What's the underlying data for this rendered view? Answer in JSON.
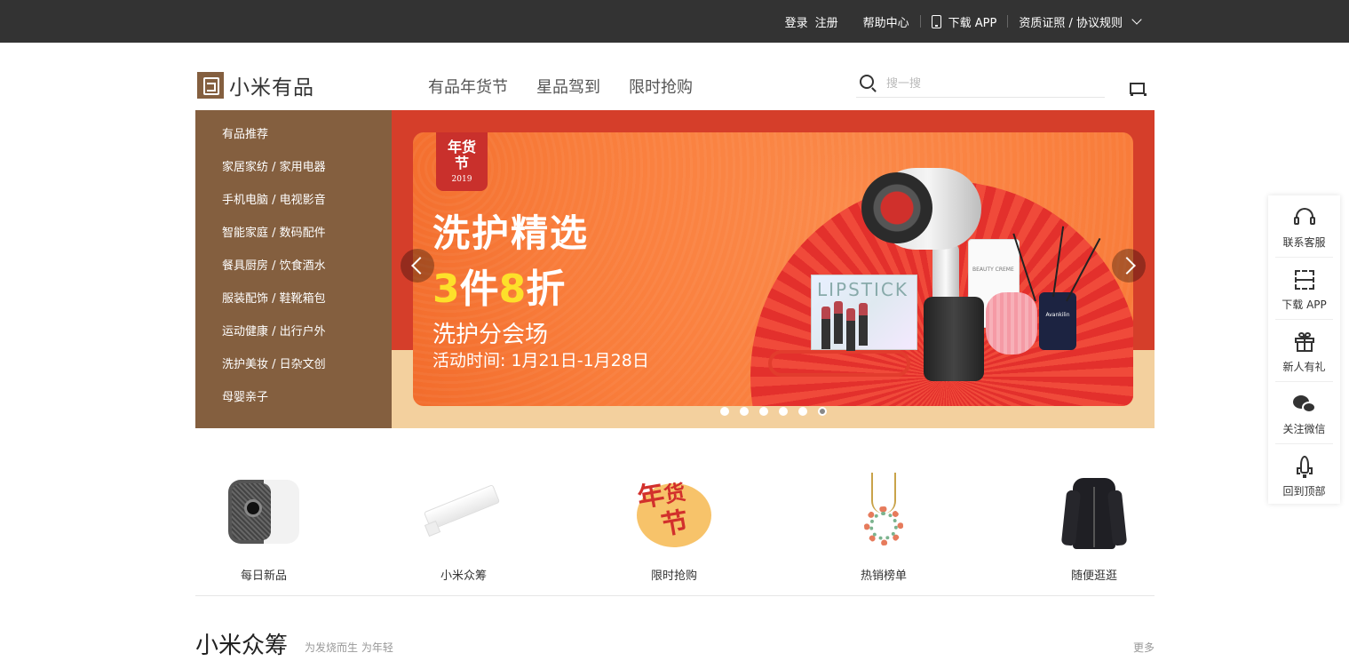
{
  "topbar": {
    "login": "登录",
    "register": "注册",
    "help": "帮助中心",
    "download": "下载 APP",
    "qualification": "资质证照 / 协议规则"
  },
  "header": {
    "logo_text": "小米有品",
    "nav": [
      "有品年货节",
      "星品驾到",
      "限时抢购"
    ],
    "search_placeholder": "搜一搜"
  },
  "sidemenu": [
    "有品推荐",
    "家居家纺 / 家用电器",
    "手机电脑 / 电视影音",
    "智能家庭 / 数码配件",
    "餐具厨房 / 饮食酒水",
    "服装配饰 / 鞋靴箱包",
    "运动健康 / 出行户外",
    "洗护美妆 / 日杂文创",
    "母婴亲子"
  ],
  "banner": {
    "stamp_line1": "年货",
    "stamp_line2": "节",
    "stamp_year": "2019",
    "title": "洗护精选",
    "offer_part1": "3",
    "offer_part2": "件",
    "offer_part3": "8",
    "offer_part4": "折",
    "subtitle": "洗护分会场",
    "date": "活动时间: 1月21日-1月28日",
    "lipstick_box": "LIPSTICK",
    "tube_text": "BEAUTY CREME",
    "bottle_text": "Avankilin",
    "dots_count": 6,
    "active_dot": 6
  },
  "categories": [
    {
      "label": "每日新品",
      "icon": "projector-icon"
    },
    {
      "label": "小米众筹",
      "icon": "light-bar-icon"
    },
    {
      "label": "限时抢购",
      "icon": "new-year-badge-icon"
    },
    {
      "label": "热销榜单",
      "icon": "necklace-icon"
    },
    {
      "label": "随便逛逛",
      "icon": "jacket-icon"
    }
  ],
  "new_year_badge": {
    "line1": "年",
    "line2": "节",
    "line3": "货"
  },
  "section": {
    "title": "小米众筹",
    "subtitle": "为发烧而生 为年轻",
    "more": "更多"
  },
  "floatbar": [
    "联系客服",
    "下载 APP",
    "新人有礼",
    "关注微信",
    "回到顶部"
  ],
  "colors": {
    "topbar": "#333333",
    "brand": "#845f3f",
    "banner_red": "#d53e2a",
    "banner_orange": "#f97d3b",
    "accent_yellow": "#fde02a"
  }
}
